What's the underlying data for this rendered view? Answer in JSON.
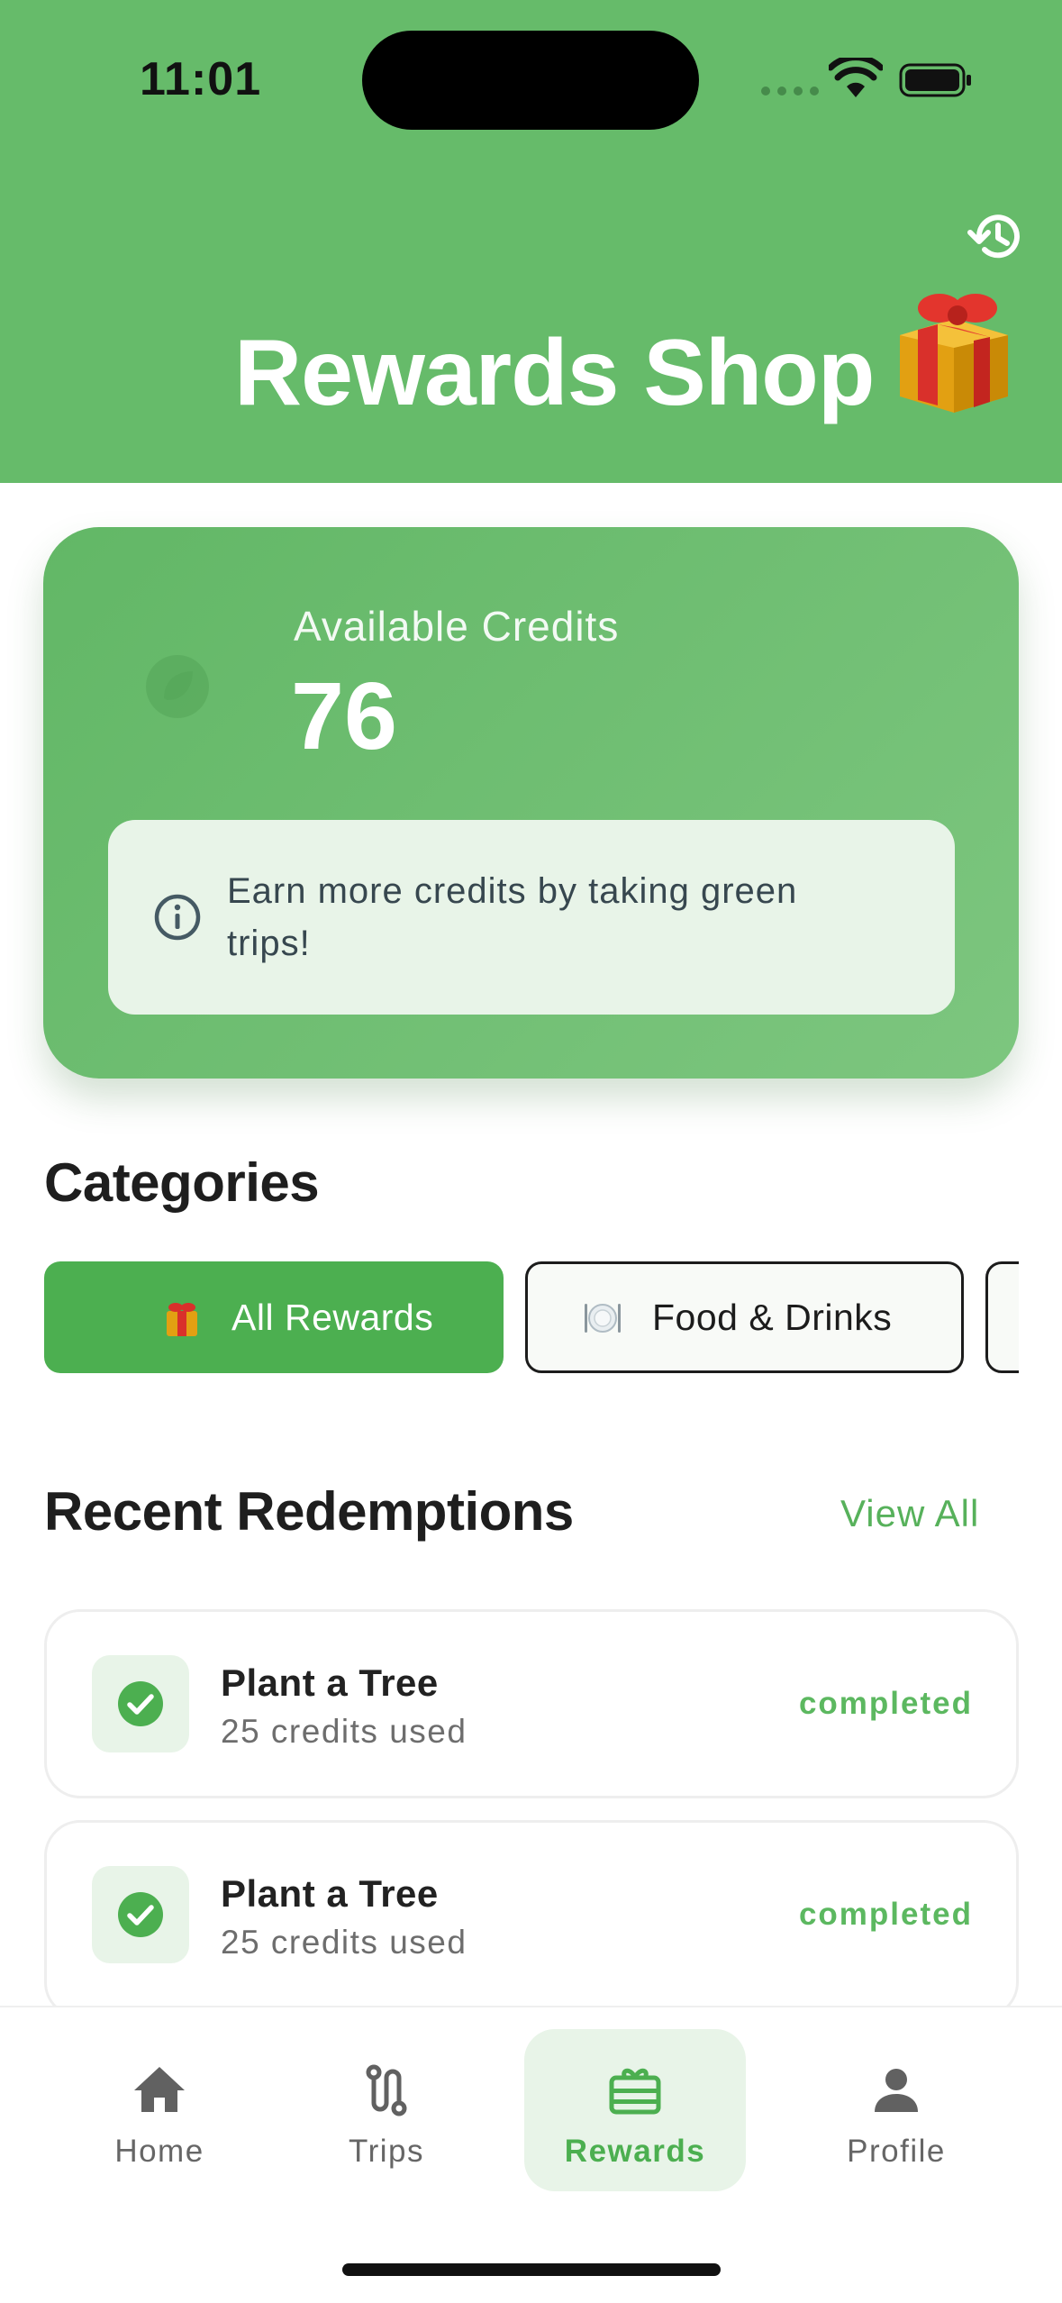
{
  "status_bar": {
    "time": "11:01"
  },
  "header": {
    "title": "Rewards Shop",
    "history_icon": "history-icon",
    "gift_icon": "gift-icon"
  },
  "credits": {
    "label": "Available Credits",
    "value": "76",
    "info_text": "Earn more credits by taking green trips!"
  },
  "categories": {
    "title": "Categories",
    "chips": [
      {
        "label": "All Rewards",
        "icon": "gift-icon",
        "selected": true
      },
      {
        "label": "Food & Drinks",
        "icon": "plate-icon",
        "selected": false
      }
    ]
  },
  "recent": {
    "title": "Recent Redemptions",
    "view_all": "View All",
    "items": [
      {
        "name": "Plant a Tree",
        "credits": "25 credits used",
        "status": "completed"
      },
      {
        "name": "Plant a Tree",
        "credits": "25 credits used",
        "status": "completed"
      }
    ]
  },
  "nav": {
    "items": [
      {
        "label": "Home",
        "icon": "home-icon"
      },
      {
        "label": "Trips",
        "icon": "route-icon"
      },
      {
        "label": "Rewards",
        "icon": "card-giftcard-icon",
        "active": true
      },
      {
        "label": "Profile",
        "icon": "person-icon"
      }
    ]
  },
  "colors": {
    "primary": "#66bb6a",
    "accent": "#4caf50",
    "tint": "#e8f4e8"
  }
}
